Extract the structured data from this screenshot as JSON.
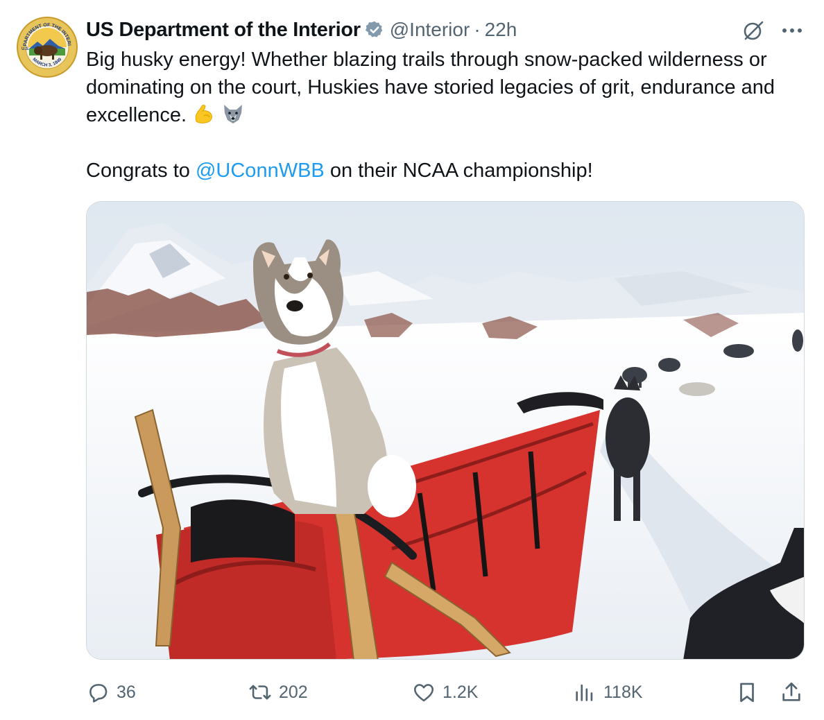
{
  "author": {
    "display_name": "US Department of the Interior",
    "handle": "@Interior",
    "separator": "·",
    "time": "22h",
    "avatar_icon": "doi-seal-icon",
    "seal_top_text": "DEPARTMENT OF THE INTERIOR",
    "seal_side_text": "U.S.",
    "seal_bottom_text": "MARCH 3, 1849",
    "verified_color": "#829aab"
  },
  "tweet": {
    "line1": "Big husky energy! Whether blazing trails through snow-packed wilderness or dominating on the court, Huskies have storied legacies of grit, endurance and excellence.",
    "emoji1": "flexed-biceps-icon",
    "emoji2": "wolf-face-icon",
    "congrats_prefix": "Congrats to ",
    "mention": "@UConnWBB",
    "congrats_suffix": " on their NCAA championship!"
  },
  "media": {
    "icon": "sled-dog-photo"
  },
  "actions": {
    "replies": "36",
    "reposts": "202",
    "likes": "1.2K",
    "views": "118K"
  },
  "colors": {
    "text": "#0f1419",
    "secondary": "#536471",
    "link": "#1d9bf0",
    "border": "#cfd9de"
  }
}
